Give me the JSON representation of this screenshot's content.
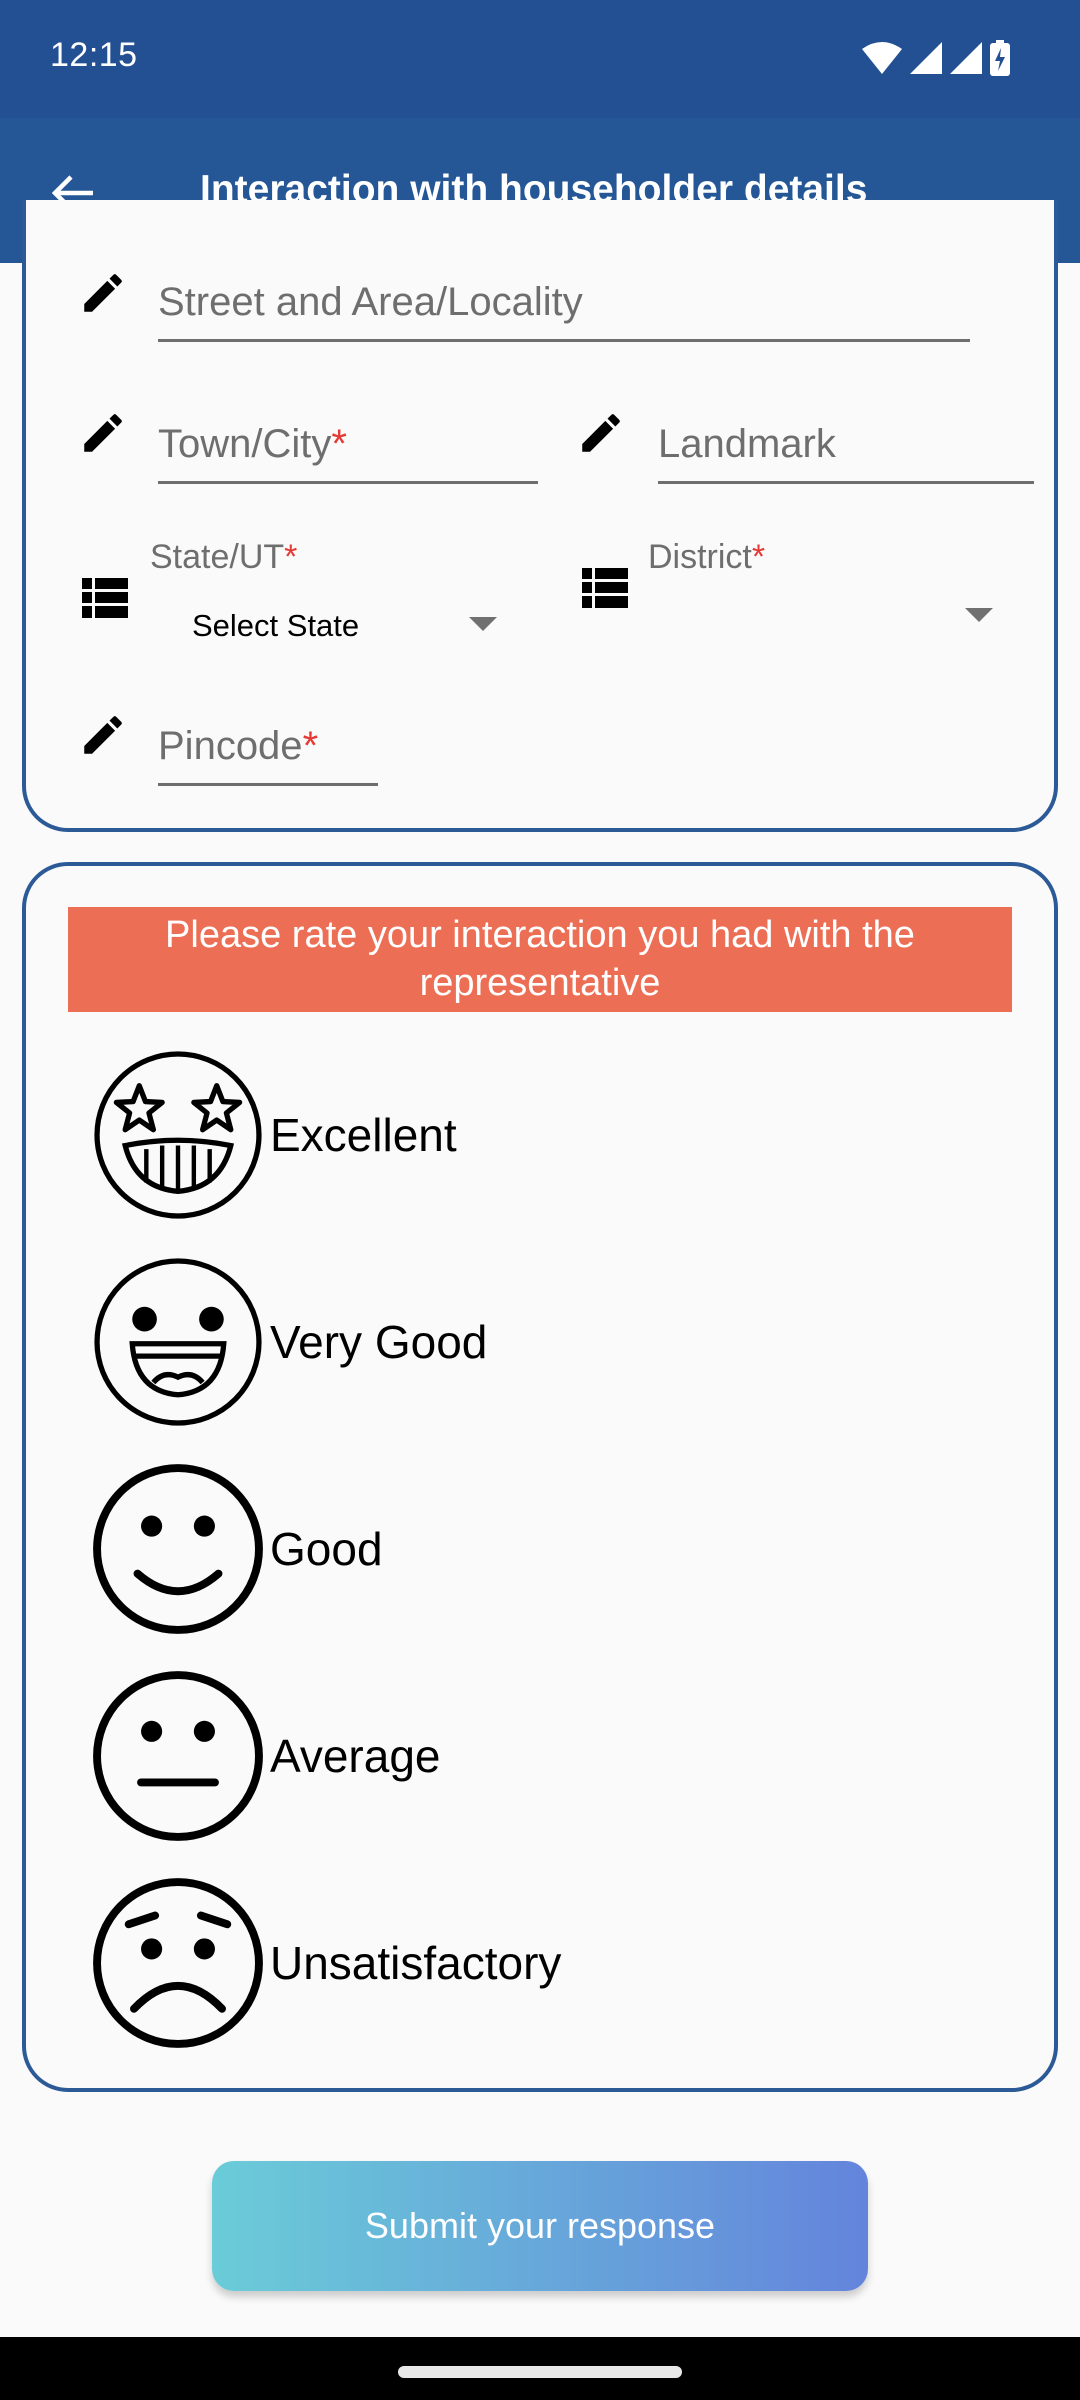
{
  "status_bar": {
    "time": "12:15",
    "icons": [
      "wifi-icon",
      "signal-icon",
      "signal-icon",
      "battery-charging-icon"
    ]
  },
  "app_bar": {
    "back_icon": "arrow-back-icon",
    "title": "Interaction with householder details"
  },
  "address_form": {
    "street": {
      "placeholder": "Street and Area/Locality",
      "required": false,
      "icon": "pencil-icon"
    },
    "town": {
      "placeholder": "Town/City",
      "required": true,
      "required_mark": "*",
      "icon": "pencil-icon"
    },
    "landmark": {
      "placeholder": "Landmark",
      "required": false,
      "icon": "pencil-icon"
    },
    "state": {
      "label": "State/UT",
      "required_mark": "*",
      "value": "Select State",
      "icon": "list-icon"
    },
    "district": {
      "label": "District",
      "required_mark": "*",
      "value": "",
      "icon": "list-icon"
    },
    "pincode": {
      "placeholder": "Pincode",
      "required": true,
      "required_mark": "*",
      "icon": "pencil-icon"
    }
  },
  "rating": {
    "prompt": "Please rate your interaction you had with the representative",
    "prompt_bg": "#ec6f55",
    "options": [
      {
        "label": "Excellent",
        "icon": "star-eyes-grin-icon"
      },
      {
        "label": "Very Good",
        "icon": "big-smile-icon"
      },
      {
        "label": "Good",
        "icon": "smile-icon"
      },
      {
        "label": "Average",
        "icon": "neutral-face-icon"
      },
      {
        "label": "Unsatisfactory",
        "icon": "sad-face-icon"
      }
    ]
  },
  "submit": {
    "label": "Submit your response",
    "gradient_start": "#6accd8",
    "gradient_end": "#6484dc"
  },
  "colors": {
    "status_bar": "#234f93",
    "app_bar": "#255797",
    "card_border": "#2b5a96",
    "required": "#e53935"
  }
}
